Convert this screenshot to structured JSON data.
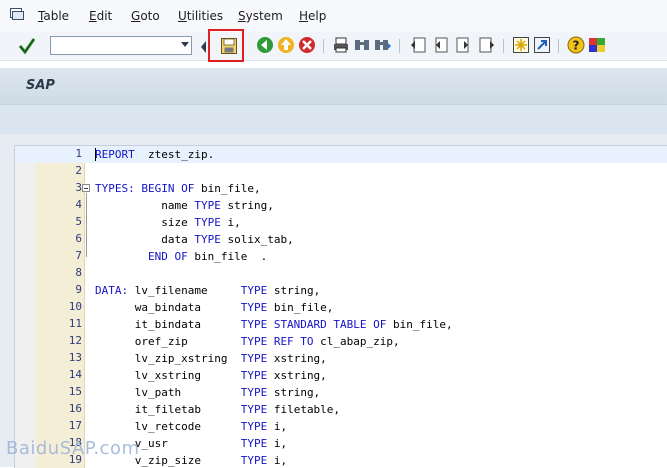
{
  "menu": {
    "items": [
      "Table",
      "Edit",
      "Goto",
      "Utilities",
      "System",
      "Help"
    ]
  },
  "toolbar": {
    "command_field_value": "",
    "icons": [
      "enter-checkmark-icon",
      "save-icon",
      "back-icon",
      "exit-icon",
      "cancel-icon",
      "print-icon",
      "find-icon",
      "find-next-icon",
      "first-page-icon",
      "previous-page-icon",
      "next-page-icon",
      "last-page-icon",
      "create-session-icon",
      "shortcut-icon",
      "help-icon",
      "customize-layout-icon"
    ],
    "highlighted_icon": "save-icon",
    "highlight_color": "#e02020"
  },
  "title": "SAP",
  "editor": {
    "current_line": 1,
    "lines": [
      {
        "num": "1",
        "tokens": [
          [
            "kw",
            "REPORT"
          ],
          [
            "",
            "  ztest_zip."
          ]
        ]
      },
      {
        "num": "2",
        "tokens": []
      },
      {
        "num": "3",
        "tokens": [
          [
            "kw",
            "TYPES: BEGIN OF"
          ],
          [
            "",
            " bin_file,"
          ]
        ]
      },
      {
        "num": "4",
        "tokens": [
          [
            "",
            "          name "
          ],
          [
            "kw",
            "TYPE"
          ],
          [
            "",
            " string,"
          ]
        ]
      },
      {
        "num": "5",
        "tokens": [
          [
            "",
            "          size "
          ],
          [
            "kw",
            "TYPE"
          ],
          [
            "",
            " i,"
          ]
        ]
      },
      {
        "num": "6",
        "tokens": [
          [
            "",
            "          data "
          ],
          [
            "kw",
            "TYPE"
          ],
          [
            "",
            " solix_tab,"
          ]
        ]
      },
      {
        "num": "7",
        "tokens": [
          [
            "kw",
            "        END OF"
          ],
          [
            "",
            " bin_file  ."
          ]
        ]
      },
      {
        "num": "8",
        "tokens": []
      },
      {
        "num": "9",
        "tokens": [
          [
            "kw",
            "DATA:"
          ],
          [
            "",
            " lv_filename     "
          ],
          [
            "kw",
            "TYPE"
          ],
          [
            "",
            " string,"
          ]
        ]
      },
      {
        "num": "10",
        "tokens": [
          [
            "",
            "      wa_bindata      "
          ],
          [
            "kw",
            "TYPE"
          ],
          [
            "",
            " bin_file,"
          ]
        ]
      },
      {
        "num": "11",
        "tokens": [
          [
            "",
            "      it_bindata      "
          ],
          [
            "kw",
            "TYPE STANDARD TABLE OF"
          ],
          [
            "",
            " bin_file,"
          ]
        ]
      },
      {
        "num": "12",
        "tokens": [
          [
            "",
            "      oref_zip        "
          ],
          [
            "kw",
            "TYPE REF TO"
          ],
          [
            "",
            " cl_abap_zip,"
          ]
        ]
      },
      {
        "num": "13",
        "tokens": [
          [
            "",
            "      lv_zip_xstring  "
          ],
          [
            "kw",
            "TYPE"
          ],
          [
            "",
            " xstring,"
          ]
        ]
      },
      {
        "num": "14",
        "tokens": [
          [
            "",
            "      lv_xstring      "
          ],
          [
            "kw",
            "TYPE"
          ],
          [
            "",
            " xstring,"
          ]
        ]
      },
      {
        "num": "15",
        "tokens": [
          [
            "",
            "      lv_path         "
          ],
          [
            "kw",
            "TYPE"
          ],
          [
            "",
            " string,"
          ]
        ]
      },
      {
        "num": "16",
        "tokens": [
          [
            "",
            "      it_filetab      "
          ],
          [
            "kw",
            "TYPE"
          ],
          [
            "",
            " filetable,"
          ]
        ]
      },
      {
        "num": "17",
        "tokens": [
          [
            "",
            "      lv_retcode      "
          ],
          [
            "kw",
            "TYPE"
          ],
          [
            "",
            " i,"
          ]
        ]
      },
      {
        "num": "18",
        "tokens": [
          [
            "",
            "      v_usr           "
          ],
          [
            "kw",
            "TYPE"
          ],
          [
            "",
            " i,"
          ]
        ]
      },
      {
        "num": "19",
        "tokens": [
          [
            "",
            "      v_zip_size      "
          ],
          [
            "kw",
            "TYPE"
          ],
          [
            "",
            " i,"
          ]
        ]
      }
    ]
  },
  "watermark": "BaiduSAP.com",
  "colors": {
    "keyword": "#1414c8",
    "line_number_bg": "#f5eed6",
    "current_line_bg": "#e8f2fe"
  }
}
